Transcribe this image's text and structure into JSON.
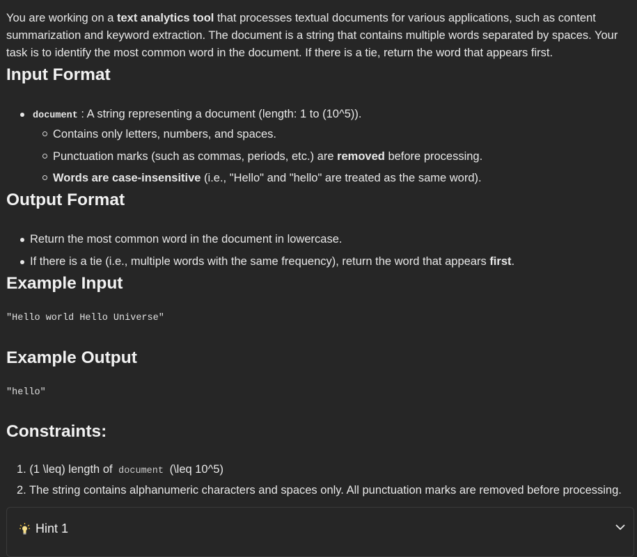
{
  "intro": {
    "t1": "You are working on a ",
    "b1": "text analytics tool",
    "t2": " that processes textual documents for various applications, such as content summarization and keyword extraction. The document is a string that contains multiple words separated by spaces. Your task is to identify the most common word in the document. If there is a tie, return the word that appears first."
  },
  "input_format": {
    "heading": "Input Format",
    "param_code": "document",
    "param_desc": " : A string representing a document (length: 1 to (10^5)).",
    "sub1": "Contains only letters, numbers, and spaces.",
    "sub2_a": "Punctuation marks (such as commas, periods, etc.) are ",
    "sub2_b": "removed",
    "sub2_c": " before processing.",
    "sub3_b": "Words are case-insensitive",
    "sub3_c": " (i.e., \"Hello\" and \"hello\" are treated as the same word)."
  },
  "output_format": {
    "heading": "Output Format",
    "item1": "Return the most common word in the document in lowercase.",
    "item2_a": "If there is a tie (i.e., multiple words with the same frequency), return the word that appears ",
    "item2_b": "first",
    "item2_c": "."
  },
  "example_input": {
    "heading": "Example Input",
    "code": "\"Hello world Hello Universe\""
  },
  "example_output": {
    "heading": "Example Output",
    "code": "\"hello\""
  },
  "constraints": {
    "heading": "Constraints:",
    "c1_a": "1. (1 \\leq) length of ",
    "c1_code": "document",
    "c1_b": " (\\leq 10^5)",
    "c2": "2. The string contains alphanumeric characters and spaces only. All punctuation marks are removed before processing."
  },
  "hint": {
    "label": "Hint 1",
    "icon": "lightbulb-icon",
    "toggle_icon": "chevron-down-icon"
  }
}
